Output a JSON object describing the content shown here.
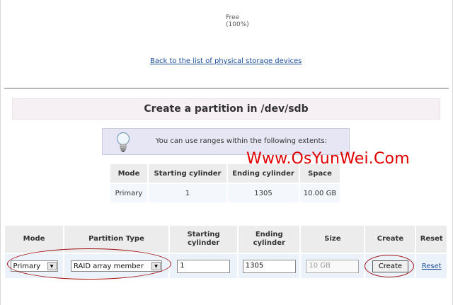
{
  "free": {
    "label": "Free",
    "percent": "(100%)"
  },
  "back_link": "Back to the list of physical storage devices",
  "title": "Create a partition in /dev/sdb",
  "info": {
    "text": "You can use ranges within the following extents:",
    "icon": "lightbulb-icon"
  },
  "watermark": "Www.OsYunWei.Com",
  "extents": {
    "headers": [
      "Mode",
      "Starting cylinder",
      "Ending cylinder",
      "Space"
    ],
    "row": [
      "Primary",
      "1",
      "1305",
      "10.00 GB"
    ]
  },
  "form": {
    "headers": {
      "mode": "Mode",
      "partition_type": "Partition Type",
      "start_1": "Starting",
      "start_2": "cylinder",
      "end_1": "Ending",
      "end_2": "cylinder",
      "size": "Size",
      "create": "Create",
      "reset": "Reset"
    },
    "mode_value": "Primary",
    "partition_type_value": "RAID array member",
    "start_value": "1",
    "end_value": "1305",
    "size_value": "10 GB",
    "create_label": "Create",
    "reset_label": "Reset"
  },
  "colors": {
    "link": "#1a4d99",
    "watermark": "#e00000",
    "annotation": "#a01010"
  }
}
